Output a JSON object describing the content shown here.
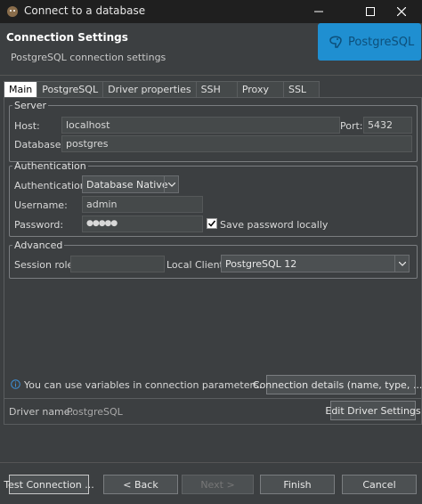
{
  "window": {
    "title": "Connect to a database",
    "app_icon": "dbeaver-beaver-icon",
    "controls": {
      "minimize": "minimize-icon",
      "maximize": "maximize-icon",
      "close": "close-icon"
    }
  },
  "header": {
    "title": "Connection Settings",
    "subtitle": "PostgreSQL connection settings",
    "logo_text": "PostgreSQL",
    "logo_icon": "postgresql-elephant-icon",
    "logo_color": "#1f8fd1"
  },
  "tabs": [
    {
      "label": "Main",
      "active": true
    },
    {
      "label": "PostgreSQL",
      "active": false
    },
    {
      "label": "Driver properties",
      "active": false
    },
    {
      "label": "SSH",
      "active": false
    },
    {
      "label": "Proxy",
      "active": false
    },
    {
      "label": "SSL",
      "active": false
    }
  ],
  "server": {
    "legend": "Server",
    "host_label": "Host:",
    "host_value": "localhost",
    "port_label": "Port:",
    "port_value": "5432",
    "database_label": "Database:",
    "database_value": "postgres"
  },
  "authentication": {
    "legend": "Authentication",
    "method_label": "Authentication:",
    "method_value": "Database Native",
    "username_label": "Username:",
    "username_value": "admin",
    "password_label": "Password:",
    "password_value": "●●●●●",
    "save_password_label": "Save password locally",
    "save_password_checked": true
  },
  "advanced": {
    "legend": "Advanced",
    "session_role_label": "Session role:",
    "session_role_value": "",
    "local_client_label": "Local Client:",
    "local_client_value": "PostgreSQL 12"
  },
  "info": {
    "icon": "info-icon",
    "text": "You can use variables in connection parameters.",
    "details_button": "Connection details (name, type, ... )"
  },
  "driver": {
    "name_label": "Driver name:",
    "name_value": "PostgreSQL",
    "edit_button": "Edit Driver Settings"
  },
  "footer": {
    "test_button": "Test Connection ...",
    "back_button": "< Back",
    "next_button": "Next >",
    "finish_button": "Finish",
    "cancel_button": "Cancel"
  }
}
